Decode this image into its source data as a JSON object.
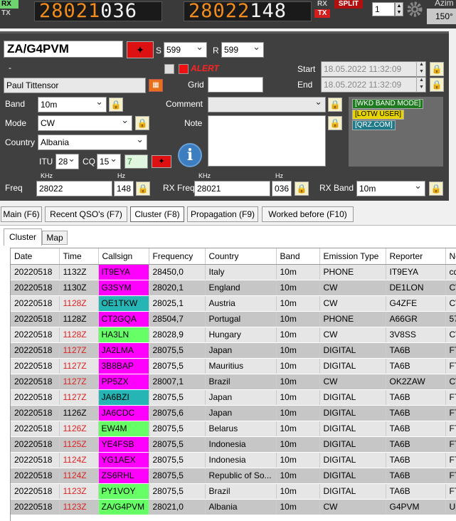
{
  "topbar": {
    "rx_label": "RX",
    "tx_label": "TX",
    "rx_freq_main": "28021",
    "rx_freq_sub": "036",
    "tx_freq_main": "28022",
    "tx_freq_sub": "148",
    "rx_indicator": "RX",
    "tx_indicator": "TX",
    "split_label": "SPLIT",
    "spinner_value": "1",
    "azimuth_label": "Azim",
    "azimuth_value": "150°"
  },
  "qso": {
    "callsign": "ZA/G4PVM",
    "s_label": "S",
    "s_value": "599",
    "r_label": "R",
    "r_value": "599",
    "dash": "-",
    "alert_label": "ALERT",
    "name": "Paul Tittensor",
    "grid_label": "Grid",
    "grid_value": "",
    "start_label": "Start",
    "start_value": "18.05.2022 11:32:09",
    "end_label": "End",
    "end_value": "18.05.2022 11:32:09",
    "band_label": "Band",
    "band_value": "10m",
    "comment_label": "Comment",
    "comment_value": "",
    "mode_label": "Mode",
    "mode_value": "CW",
    "note_label": "Note",
    "country_label": "Country",
    "country_value": "Albania",
    "itu_label": "ITU",
    "itu_value": "28",
    "cq_label": "CQ",
    "cq_value": "15",
    "zone_value": "7",
    "khz_label": "KHz",
    "hz_label": "Hz",
    "freq_label": "Freq",
    "freq_khz": "28022",
    "freq_hz": "148",
    "rxfreq_label": "RX Freq",
    "rxfreq_khz": "28021",
    "rxfreq_hz": "036",
    "rxband_label": "RX Band",
    "rxband_value": "10m",
    "badges": [
      {
        "text": "[WKD BAND MODE]",
        "bg": "#1e7a1e"
      },
      {
        "text": "[LOTW USER]",
        "bg": "#e8d400"
      },
      {
        "text": "[QRZ.COM]",
        "bg": "#1e7a8a"
      }
    ]
  },
  "main_tabs": [
    "Main (F6)",
    "Recent QSO's (F7)",
    "Cluster (F8)",
    "Propagation (F9)",
    "Worked before (F10)"
  ],
  "sub_tabs": [
    "Cluster",
    "Map"
  ],
  "cluster": {
    "columns": [
      "Date",
      "Time",
      "Callsign",
      "Frequency",
      "Country",
      "Band",
      "Emission Type",
      "Reporter",
      "No"
    ],
    "rows": [
      {
        "date": "20220518",
        "time": "1132Z",
        "red": false,
        "call": "IT9EYA",
        "cs_bg": "#ff00ff",
        "freq": "28450,0",
        "country": "Italy",
        "band": "10m",
        "mode": "PHONE",
        "rep": "IT9EYA",
        "note": "cq"
      },
      {
        "date": "20220518",
        "time": "1130Z",
        "red": false,
        "call": "G3SYM",
        "cs_bg": "#ff00ff",
        "freq": "28020,1",
        "country": "England",
        "band": "10m",
        "mode": "CW",
        "rep": "DE1LON",
        "note": "CV"
      },
      {
        "date": "20220518",
        "time": "1128Z",
        "red": true,
        "call": "OE1TKW",
        "cs_bg": "#26b5b5",
        "freq": "28025,1",
        "country": "Austria",
        "band": "10m",
        "mode": "CW",
        "rep": "G4ZFE",
        "note": "CV"
      },
      {
        "date": "20220518",
        "time": "1128Z",
        "red": false,
        "call": "CT2GQA",
        "cs_bg": "#ff00ff",
        "freq": "28504,7",
        "country": "Portugal",
        "band": "10m",
        "mode": "PHONE",
        "rep": "A66GR",
        "note": "57"
      },
      {
        "date": "20220518",
        "time": "1128Z",
        "red": true,
        "call": "HA3LN",
        "cs_bg": "#66ff66",
        "freq": "28028,9",
        "country": "Hungary",
        "band": "10m",
        "mode": "CW",
        "rep": "3V8SS",
        "note": "CV"
      },
      {
        "date": "20220518",
        "time": "1127Z",
        "red": true,
        "call": "JA2LMA",
        "cs_bg": "#ff00ff",
        "freq": "28075,5",
        "country": "Japan",
        "band": "10m",
        "mode": "DIGITAL",
        "rep": "TA6B",
        "note": "FT"
      },
      {
        "date": "20220518",
        "time": "1127Z",
        "red": true,
        "call": "3B8BAP",
        "cs_bg": "#ff00ff",
        "freq": "28075,5",
        "country": "Mauritius",
        "band": "10m",
        "mode": "DIGITAL",
        "rep": "TA6B",
        "note": "FT"
      },
      {
        "date": "20220518",
        "time": "1127Z",
        "red": true,
        "call": "PP5ZX",
        "cs_bg": "#ff00ff",
        "freq": "28007,1",
        "country": "Brazil",
        "band": "10m",
        "mode": "CW",
        "rep": "OK2ZAW",
        "note": "CV"
      },
      {
        "date": "20220518",
        "time": "1127Z",
        "red": true,
        "call": "JA6BZI",
        "cs_bg": "#26b5b5",
        "freq": "28075,5",
        "country": "Japan",
        "band": "10m",
        "mode": "DIGITAL",
        "rep": "TA6B",
        "note": "FT"
      },
      {
        "date": "20220518",
        "time": "1126Z",
        "red": false,
        "call": "JA6CDC",
        "cs_bg": "#ff00ff",
        "freq": "28075,6",
        "country": "Japan",
        "band": "10m",
        "mode": "DIGITAL",
        "rep": "TA6B",
        "note": "FT"
      },
      {
        "date": "20220518",
        "time": "1126Z",
        "red": true,
        "call": "EW4M",
        "cs_bg": "#66ff66",
        "freq": "28075,5",
        "country": "Belarus",
        "band": "10m",
        "mode": "DIGITAL",
        "rep": "TA6B",
        "note": "FT"
      },
      {
        "date": "20220518",
        "time": "1125Z",
        "red": true,
        "call": "YE4FSB",
        "cs_bg": "#ff00ff",
        "freq": "28075,5",
        "country": "Indonesia",
        "band": "10m",
        "mode": "DIGITAL",
        "rep": "TA6B",
        "note": "FT"
      },
      {
        "date": "20220518",
        "time": "1124Z",
        "red": true,
        "call": "YG1AEX",
        "cs_bg": "#ff00ff",
        "freq": "28075,5",
        "country": "Indonesia",
        "band": "10m",
        "mode": "DIGITAL",
        "rep": "TA6B",
        "note": "FT"
      },
      {
        "date": "20220518",
        "time": "1124Z",
        "red": true,
        "call": "ZS6RHL",
        "cs_bg": "#ff00ff",
        "freq": "28075,5",
        "country": "Republic of So...",
        "band": "10m",
        "mode": "DIGITAL",
        "rep": "TA6B",
        "note": "FT"
      },
      {
        "date": "20220518",
        "time": "1123Z",
        "red": true,
        "call": "PY1VOY",
        "cs_bg": "#66ff66",
        "freq": "28075,5",
        "country": "Brazil",
        "band": "10m",
        "mode": "DIGITAL",
        "rep": "TA6B",
        "note": "FT"
      },
      {
        "date": "20220518",
        "time": "1123Z",
        "red": true,
        "call": "ZA/G4PVM",
        "cs_bg": "#66ff66",
        "freq": "28021,0",
        "country": "Albania",
        "band": "10m",
        "mode": "CW",
        "rep": "G4PVM",
        "note": "Up"
      }
    ]
  }
}
